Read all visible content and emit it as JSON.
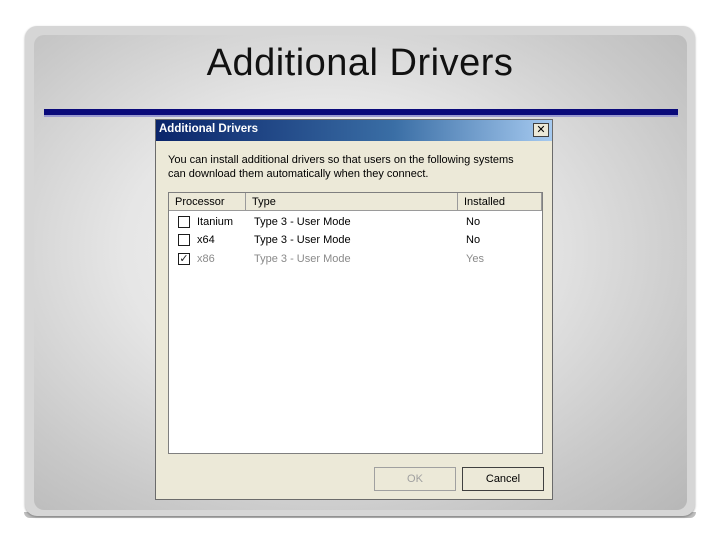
{
  "slide": {
    "title": "Additional Drivers"
  },
  "dialog": {
    "title": "Additional Drivers",
    "close_label": "✕",
    "description_line1": "You can install additional drivers so that users on the following systems",
    "description_line2": "can download them automatically when they connect.",
    "columns": [
      "Processor",
      "Type",
      "Installed"
    ],
    "rows": [
      {
        "processor": "Itanium",
        "type": "Type 3 - User Mode",
        "installed": "No",
        "checked": false
      },
      {
        "processor": "x64",
        "type": "Type 3 - User Mode",
        "installed": "No",
        "checked": false
      },
      {
        "processor": "x86",
        "type": "Type 3 - User Mode",
        "installed": "Yes",
        "checked": true
      }
    ],
    "ok_label": "OK",
    "cancel_label": "Cancel",
    "check_glyph": "✓"
  },
  "colors": {
    "title_rule": "#0a0a7a",
    "titlebar_start": "#0a246a",
    "titlebar_end": "#a6caf0"
  }
}
